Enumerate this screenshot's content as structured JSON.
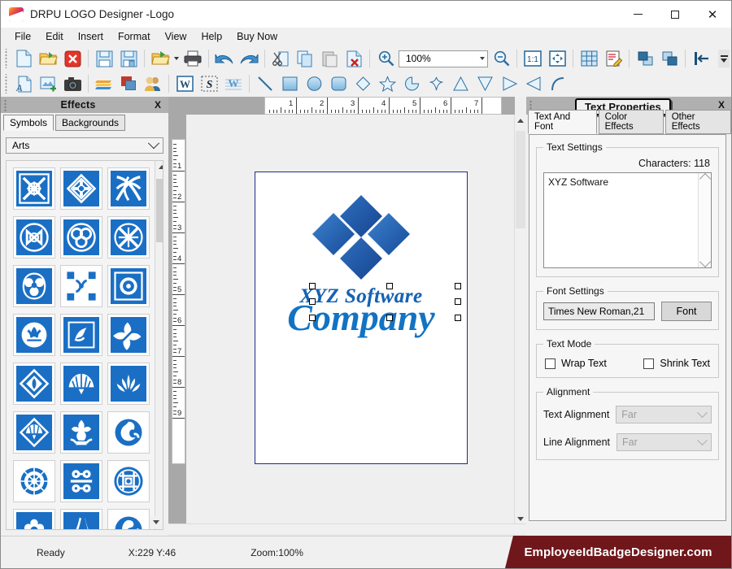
{
  "window": {
    "title": "DRPU LOGO Designer -Logo",
    "app_icon": "rainbow-logo-icon",
    "minimize": "minimize-icon",
    "maximize": "maximize-icon",
    "close": "close-icon"
  },
  "menubar": {
    "items": [
      {
        "label": "File"
      },
      {
        "label": "Edit"
      },
      {
        "label": "Insert"
      },
      {
        "label": "Format"
      },
      {
        "label": "View"
      },
      {
        "label": "Help"
      },
      {
        "label": "Buy Now"
      }
    ]
  },
  "toolbar_top": {
    "zoom_value": "100%",
    "buttons": [
      {
        "name": "new-document-icon"
      },
      {
        "name": "open-folder-icon"
      },
      {
        "name": "close-document-icon"
      },
      {
        "name": "save-icon"
      },
      {
        "name": "save-as-icon"
      },
      {
        "name": "export-icon"
      },
      {
        "name": "print-icon"
      },
      {
        "name": "undo-icon"
      },
      {
        "name": "redo-icon"
      },
      {
        "name": "cut-icon"
      },
      {
        "name": "copy-icon"
      },
      {
        "name": "paste-icon"
      },
      {
        "name": "delete-icon"
      },
      {
        "name": "zoom-in-icon"
      },
      {
        "name": "zoom-out-icon"
      },
      {
        "name": "actual-size-icon"
      },
      {
        "name": "fit-page-icon"
      },
      {
        "name": "grid-icon"
      },
      {
        "name": "edit-properties-icon"
      },
      {
        "name": "bring-front-icon"
      },
      {
        "name": "send-back-icon"
      },
      {
        "name": "align-left-icon"
      }
    ]
  },
  "toolbar_shapes": {
    "buttons": [
      {
        "name": "insert-text-icon"
      },
      {
        "name": "insert-image-icon"
      },
      {
        "name": "capture-photo-icon"
      },
      {
        "name": "layers-icon"
      },
      {
        "name": "background-icon"
      },
      {
        "name": "contacts-icon"
      },
      {
        "name": "insert-word-art-icon"
      },
      {
        "name": "signature-icon"
      },
      {
        "name": "watermark-icon"
      },
      {
        "name": "line-icon"
      },
      {
        "name": "rectangle-icon"
      },
      {
        "name": "ellipse-icon"
      },
      {
        "name": "rounded-rectangle-icon"
      },
      {
        "name": "diamond-icon"
      },
      {
        "name": "star-icon"
      },
      {
        "name": "pie-icon"
      },
      {
        "name": "four-point-star-icon"
      },
      {
        "name": "triangle-up-icon"
      },
      {
        "name": "triangle-down-icon"
      },
      {
        "name": "triangle-right-icon"
      },
      {
        "name": "triangle-left-icon"
      },
      {
        "name": "arc-icon"
      }
    ]
  },
  "effects_panel": {
    "title": "Effects",
    "close_label": "X",
    "tabs": [
      {
        "label": "Symbols",
        "active": true
      },
      {
        "label": "Backgrounds",
        "active": false
      }
    ],
    "category": "Arts",
    "symbol_count": 24
  },
  "canvas": {
    "ruler_h_labels": [
      "1",
      "2",
      "3",
      "4",
      "5",
      "6",
      "7"
    ],
    "ruler_v_labels": [
      "1",
      "2",
      "3",
      "4",
      "5",
      "6",
      "7",
      "8",
      "9"
    ],
    "logo": {
      "line1": "XYZ Software",
      "line2": "Company",
      "shape": "four-diamonds-icon",
      "border_color": "#1b2d86",
      "text_color": "#1273c4"
    }
  },
  "text_properties": {
    "title": "Text Properties",
    "close_label": "X",
    "tabs": [
      {
        "label": "Text And Font",
        "active": true
      },
      {
        "label": "Color Effects",
        "active": false
      },
      {
        "label": "Other Effects",
        "active": false
      }
    ],
    "text_settings": {
      "legend": "Text Settings",
      "characters_label": "Characters: 118",
      "value": "XYZ Software"
    },
    "font_settings": {
      "legend": "Font Settings",
      "font_value": "Times New Roman,21",
      "font_button": "Font"
    },
    "text_mode": {
      "legend": "Text Mode",
      "wrap_label": "Wrap Text",
      "wrap_checked": false,
      "shrink_label": "Shrink Text",
      "shrink_checked": false
    },
    "alignment": {
      "legend": "Alignment",
      "text_alignment_label": "Text Alignment",
      "text_alignment_value": "Far",
      "line_alignment_label": "Line Alignment",
      "line_alignment_value": "Far"
    }
  },
  "statusbar": {
    "ready": "Ready",
    "coords": "X:229  Y:46",
    "zoom": "Zoom:100%",
    "brand": "EmployeeIdBadgeDesigner.com",
    "brand_color": "#70171b"
  }
}
